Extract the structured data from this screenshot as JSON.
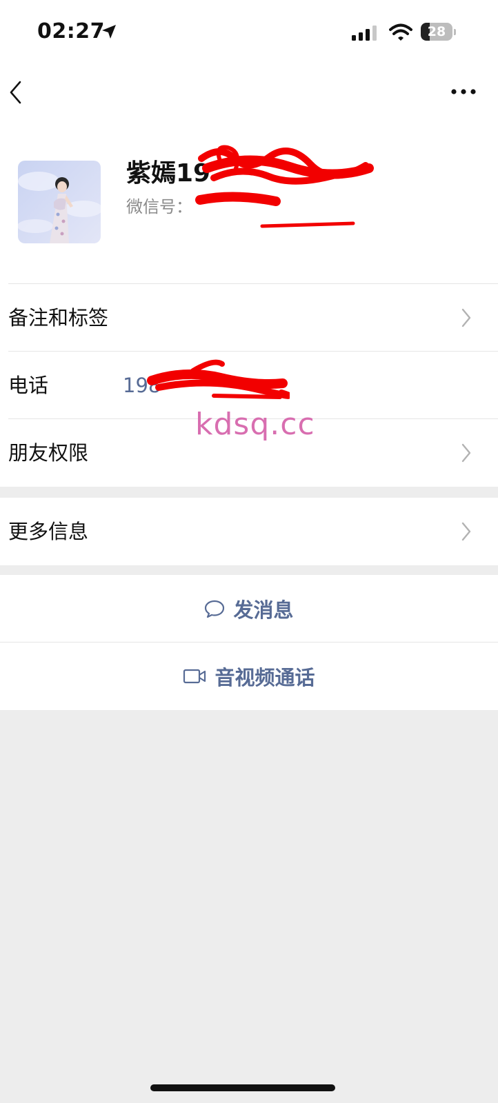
{
  "status_bar": {
    "time": "02:27",
    "battery": "28",
    "battery_level": 0.28
  },
  "nav": {
    "back_icon": "chevron-left-icon",
    "more_icon": "ellipsis-icon"
  },
  "profile": {
    "name": "紫嫣19",
    "wechat_id_label": "微信号："
  },
  "rows": {
    "remarks_tags": "备注和标签",
    "phone_label": "电话",
    "phone_value": "198",
    "friend_permissions": "朋友权限",
    "more_info": "更多信息"
  },
  "watermark": "kdsq.cc",
  "actions": {
    "send_message": "发消息",
    "av_call": "音视频通话"
  },
  "colors": {
    "link": "#576b95",
    "background": "#ededed",
    "watermark": "#d86eb0",
    "redaction": "#f20000"
  }
}
